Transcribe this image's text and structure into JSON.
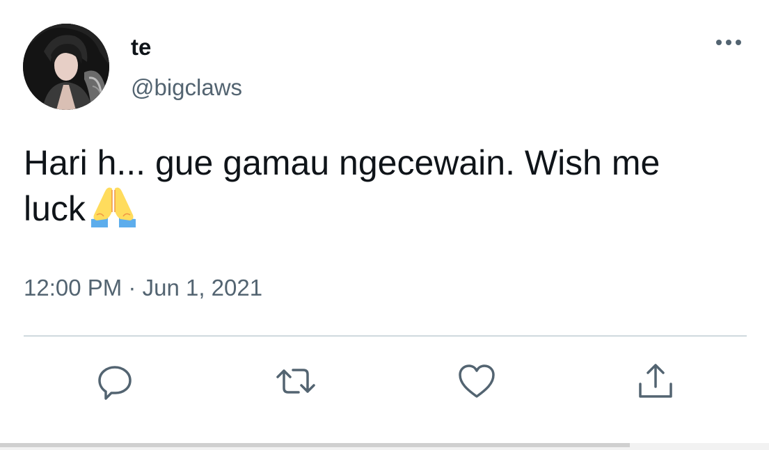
{
  "author": {
    "display_name": "te",
    "handle": "@bigclaws",
    "avatar_icon": "profile-photo"
  },
  "tweet": {
    "text": "Hari h... gue gamau ngecewain. Wish me luck",
    "emoji": "folded-hands-emoji",
    "time": "12:00 PM",
    "separator": "·",
    "date": "Jun 1, 2021"
  },
  "icons": {
    "more": "more-options-icon",
    "reply": "reply-icon",
    "retweet": "retweet-icon",
    "like": "like-icon",
    "share": "share-icon"
  },
  "colors": {
    "text_primary": "#0f1419",
    "text_secondary": "#536471",
    "divider": "#cfd9de",
    "icon": "#536471",
    "emoji_hands": "#FFDC5D",
    "emoji_sleeves": "#5DADEC"
  }
}
